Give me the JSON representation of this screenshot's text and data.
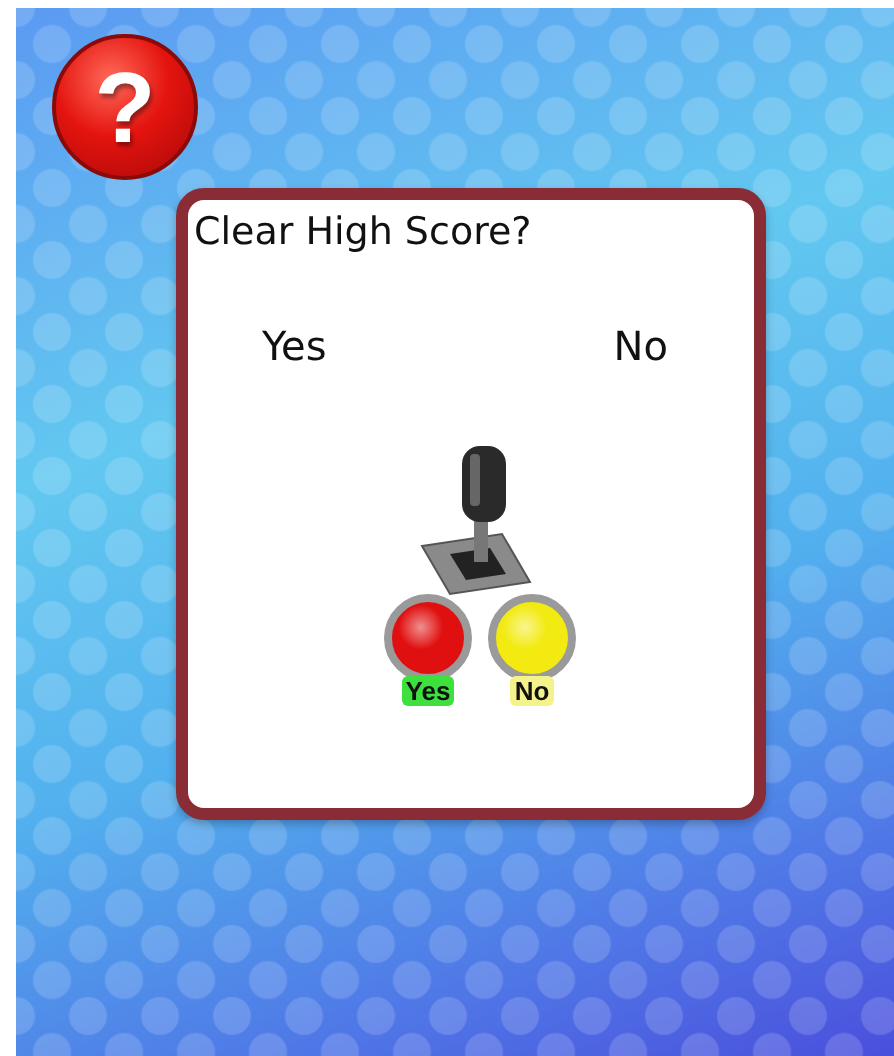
{
  "help_button": {
    "label": "?"
  },
  "dialog": {
    "title": "Clear High Score?",
    "options": [
      {
        "label": "Yes"
      },
      {
        "label": "No"
      }
    ],
    "arcade_buttons": [
      {
        "kind": "confirm",
        "color": "#e01010",
        "label": "Yes"
      },
      {
        "kind": "cancel",
        "color": "#f2ea10",
        "label": "No"
      }
    ]
  }
}
